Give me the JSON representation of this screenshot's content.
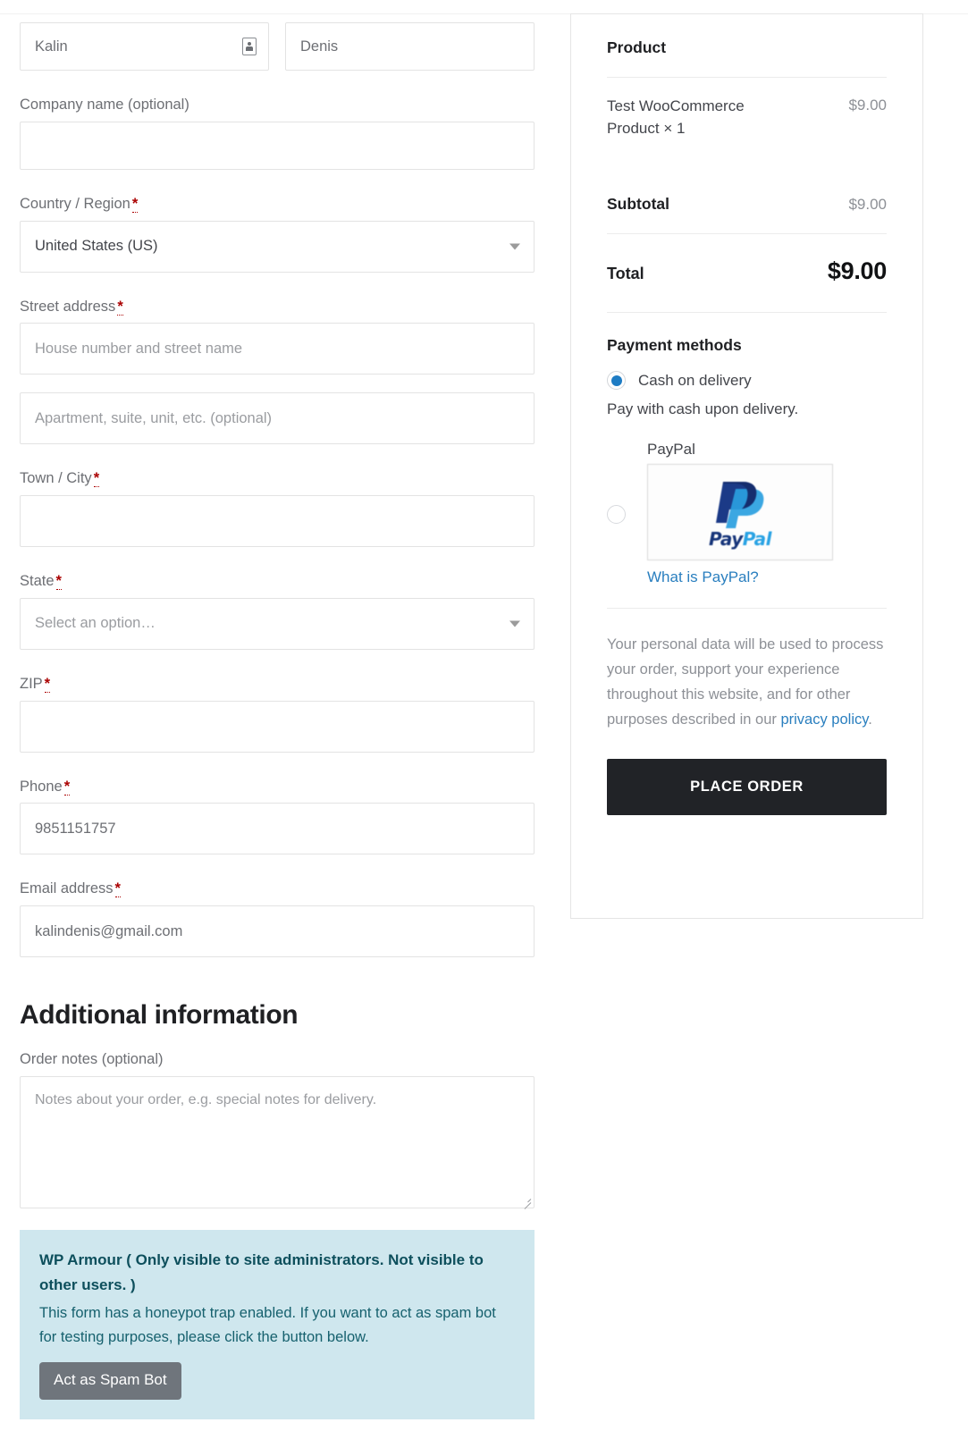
{
  "form": {
    "first_name": {
      "value": "Kalin",
      "autofill_icon": "contact-card-icon"
    },
    "last_name": {
      "value": "Denis"
    },
    "company": {
      "label": "Company name (optional)",
      "value": ""
    },
    "country": {
      "label": "Country / Region",
      "required_mark": "*",
      "value": "United States (US)"
    },
    "street": {
      "label": "Street address",
      "required_mark": "*",
      "placeholder": "House number and street name"
    },
    "street2": {
      "placeholder": "Apartment, suite, unit, etc. (optional)"
    },
    "city": {
      "label": "Town / City",
      "required_mark": "*",
      "value": ""
    },
    "state": {
      "label": "State",
      "required_mark": "*",
      "value": "Select an option…"
    },
    "zip": {
      "label": "ZIP",
      "required_mark": "*",
      "value": ""
    },
    "phone": {
      "label": "Phone",
      "required_mark": "*",
      "value": "9851151757"
    },
    "email": {
      "label": "Email address",
      "required_mark": "*",
      "value": "kalindenis@gmail.com"
    }
  },
  "additional": {
    "title": "Additional information",
    "notes_label": "Order notes (optional)",
    "notes_placeholder": "Notes about your order, e.g. special notes for delivery.",
    "notes_value": ""
  },
  "armour": {
    "title": "WP Armour ( Only visible to site administrators. Not visible to other users. )",
    "body": "This form has a honeypot trap enabled. If you want to act as spam bot for testing purposes, please click the button below.",
    "button": "Act as Spam Bot",
    "bg_color": "#cfe7ee",
    "text_color": "#0f5461",
    "button_color": "#6f757c"
  },
  "order": {
    "product_header": "Product",
    "item_name": "Test WooCommerce Product",
    "item_qty": "× 1",
    "item_price": "$9.00",
    "subtotal_label": "Subtotal",
    "subtotal_value": "$9.00",
    "total_label": "Total",
    "total_value": "$9.00"
  },
  "payment": {
    "heading": "Payment methods",
    "cod_label": "Cash on delivery",
    "cod_description": "Pay with cash upon delivery.",
    "cod_selected": true,
    "paypal_label": "PayPal",
    "paypal_logo_text_a": "Pay",
    "paypal_logo_text_b": "Pal",
    "paypal_link": "What is PayPal?",
    "paypal_selected": false,
    "selected_color": "#1e7cc4",
    "link_color": "#2a7fbf"
  },
  "privacy": {
    "text_before": "Your personal data will be used to process your order, support your experience throughout this website, and for other purposes described in our ",
    "link": "privacy policy",
    "text_after": "."
  },
  "actions": {
    "place_order": "Place order",
    "place_order_bg": "#212327"
  }
}
